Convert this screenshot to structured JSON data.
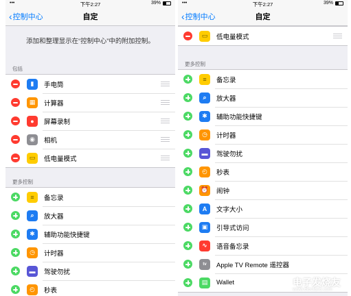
{
  "colors": {
    "accent": "#007aff",
    "remove": "#ff3b30",
    "add": "#4cd964",
    "background": "#efeff4"
  },
  "left": {
    "status": {
      "carrier": "•••",
      "time": "下午2:27",
      "battery_text": "39%",
      "battery_level": 0.39
    },
    "nav": {
      "back_label": "控制中心",
      "title": "自定"
    },
    "description": "添加和整理显示在“控制中心”中的附加控制。",
    "include_header": "包括",
    "included": [
      {
        "label": "手电筒",
        "icon": "flashlight-icon",
        "color": "#1e7cf2"
      },
      {
        "label": "计算器",
        "icon": "calculator-icon",
        "color": "#ff9500"
      },
      {
        "label": "屏幕录制",
        "icon": "screen-record-icon",
        "color": "#ff3b30"
      },
      {
        "label": "相机",
        "icon": "camera-icon",
        "color": "#8e8e93"
      },
      {
        "label": "低电量模式",
        "icon": "low-power-icon",
        "color": "#ffcc00"
      }
    ],
    "more_header": "更多控制",
    "more": [
      {
        "label": "备忘录",
        "icon": "notes-icon",
        "color": "#ffcc00"
      },
      {
        "label": "放大器",
        "icon": "magnifier-icon",
        "color": "#1e7cf2"
      },
      {
        "label": "辅助功能快捷键",
        "icon": "accessibility-icon",
        "color": "#1e7cf2"
      },
      {
        "label": "计时器",
        "icon": "timer-icon",
        "color": "#ff9500"
      },
      {
        "label": "驾驶勿扰",
        "icon": "driving-icon",
        "color": "#5856d6"
      },
      {
        "label": "秒表",
        "icon": "stopwatch-icon",
        "color": "#ff9500"
      }
    ]
  },
  "right": {
    "status": {
      "carrier": "•••",
      "time": "下午2:27",
      "battery_text": "39%",
      "battery_level": 0.39
    },
    "nav": {
      "back_label": "控制中心",
      "title": "自定"
    },
    "included": [
      {
        "label": "低电量模式",
        "icon": "low-power-icon",
        "color": "#ffcc00"
      }
    ],
    "more_header": "更多控制",
    "more": [
      {
        "label": "备忘录",
        "icon": "notes-icon",
        "color": "#ffcc00"
      },
      {
        "label": "放大器",
        "icon": "magnifier-icon",
        "color": "#1e7cf2"
      },
      {
        "label": "辅助功能快捷键",
        "icon": "accessibility-icon",
        "color": "#1e7cf2"
      },
      {
        "label": "计时器",
        "icon": "timer-icon",
        "color": "#ff9500"
      },
      {
        "label": "驾驶勿扰",
        "icon": "driving-icon",
        "color": "#5856d6"
      },
      {
        "label": "秒表",
        "icon": "stopwatch-icon",
        "color": "#ff9500"
      },
      {
        "label": "闹钟",
        "icon": "alarm-icon",
        "color": "#ff9500"
      },
      {
        "label": "文字大小",
        "icon": "text-size-icon",
        "color": "#1e7cf2"
      },
      {
        "label": "引导式访问",
        "icon": "guided-access-icon",
        "color": "#1e7cf2"
      },
      {
        "label": "语音备忘录",
        "icon": "voice-memos-icon",
        "color": "#ff3b30"
      },
      {
        "label": "Apple TV Remote 遥控器",
        "icon": "apple-tv-remote-icon",
        "color": "#8e8e93"
      },
      {
        "label": "Wallet",
        "icon": "wallet-icon",
        "color": "#4cd964"
      }
    ]
  },
  "watermark": {
    "cn": "电子发烧友",
    "en": "www.elecfans.com"
  }
}
